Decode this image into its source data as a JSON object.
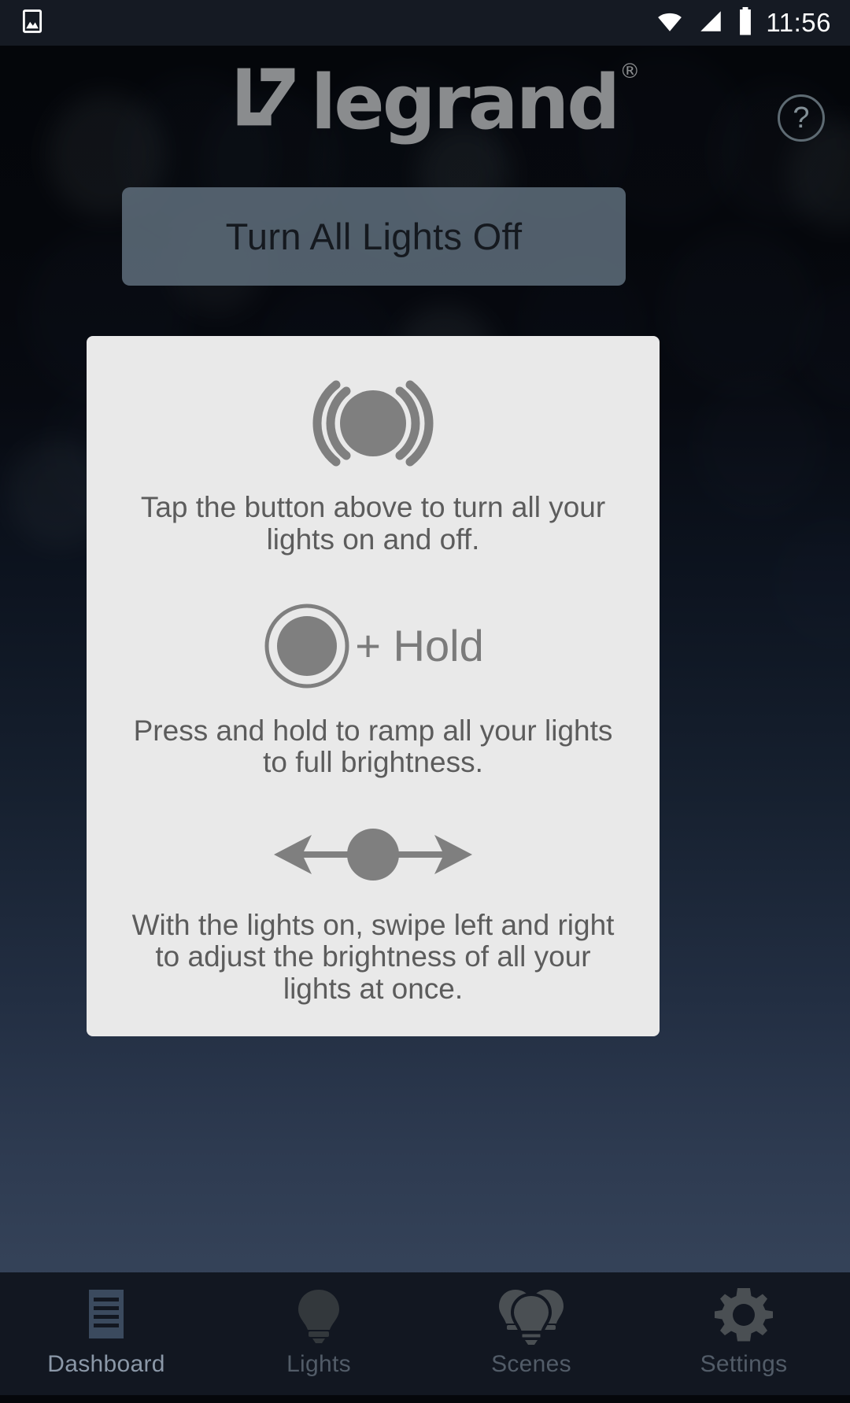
{
  "status_bar": {
    "time": "11:56",
    "icons": [
      "image-icon",
      "wifi-icon",
      "cellular-signal-icon",
      "battery-icon"
    ],
    "background_color": "#151a23"
  },
  "header": {
    "logo_text": "legrand",
    "logo_mark": "legrand-l7-mark",
    "registered_mark": "®",
    "help_label": "?",
    "help_icon": "help-circle-icon"
  },
  "main": {
    "all_lights_button": {
      "label": "Turn All Lights Off",
      "background_color": "#5c6b79",
      "text_color": "#15191f"
    },
    "help_card": {
      "background_color": "#e9e9e9",
      "text_color": "#5c5c5c",
      "icon_color": "#7f7f7f",
      "items": [
        {
          "icon": "tap-press-icon",
          "text": "Tap the button above to turn all your lights on and off."
        },
        {
          "icon": "press-hold-icon",
          "icon_label": "+ Hold",
          "text": "Press and hold to ramp all your lights to full brightness."
        },
        {
          "icon": "swipe-left-right-icon",
          "text": "With the lights on, swipe left and right to adjust the brightness of all your lights at once."
        }
      ]
    }
  },
  "bottom_nav": {
    "background_color": "#121721",
    "active_color": "#8b98a8",
    "inactive_color": "#525c68",
    "items": [
      {
        "label": "Dashboard",
        "icon": "dashboard-list-icon",
        "active": true
      },
      {
        "label": "Lights",
        "icon": "lightbulb-icon",
        "active": false
      },
      {
        "label": "Scenes",
        "icon": "multiple-bulbs-icon",
        "active": false
      },
      {
        "label": "Settings",
        "icon": "gear-icon",
        "active": false
      }
    ]
  }
}
